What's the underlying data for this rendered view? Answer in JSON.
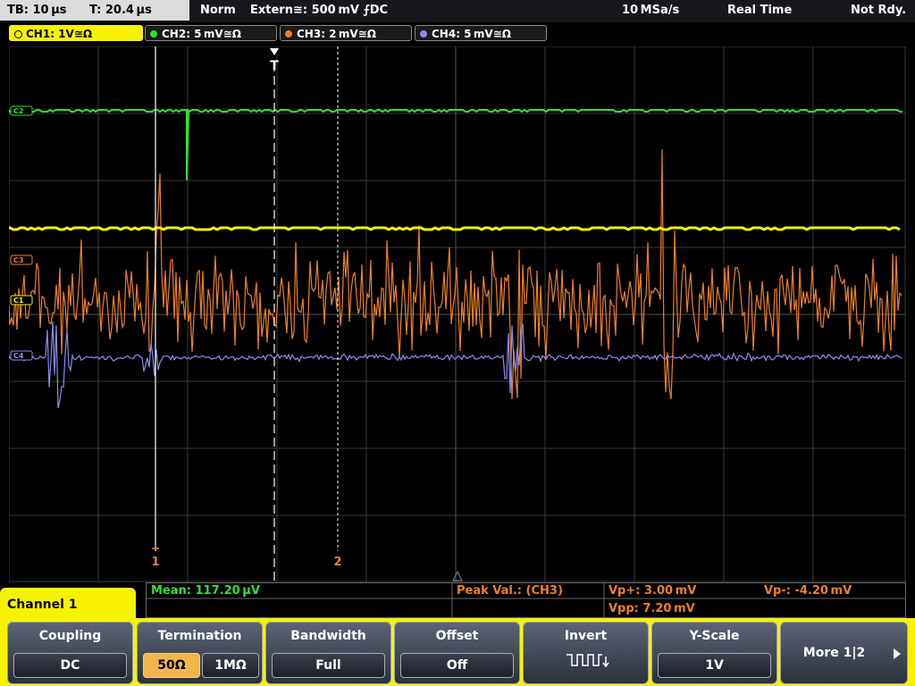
{
  "status_bar": {
    "timebase": "TB: 10 µs",
    "trigger_time": "T: 20.4 µs",
    "mode": "Norm",
    "trigger": "Extern≅: 500 mV ⨍DC",
    "sample_rate": "10 MSa/s",
    "acq_mode": "Real Time",
    "status": "Not Rdy."
  },
  "channels": [
    {
      "label": "CH1: 1V≅Ω",
      "color": "#f6f200",
      "active": true
    },
    {
      "label": "CH2: 5 mV≅Ω",
      "color": "#2fe22f",
      "active": false
    },
    {
      "label": "CH3: 2 mV≅Ω",
      "color": "#f08020",
      "active": false
    },
    {
      "label": "CH4: 5 mV≅Ω",
      "color": "#8c8cf0",
      "active": false
    }
  ],
  "markers": {
    "trigger": "T",
    "cursor1": "1",
    "cursor2": "2",
    "ch2": "C2",
    "ch3": "C3",
    "ch1": "C1",
    "ch4": "C4"
  },
  "measurements": {
    "mean": "Mean: 117.20 µV",
    "peak_label": "Peak Val.:  (CH3)",
    "vp_plus": "Vp+: 3.00 mV",
    "vp_minus": "Vp-: -4.20 mV",
    "vpp": "Vpp: 7.20 mV"
  },
  "menu": {
    "title": "Channel 1",
    "coupling": {
      "label": "Coupling",
      "value": "DC"
    },
    "termination": {
      "label": "Termination",
      "opt1": "50Ω",
      "opt2": "1MΩ"
    },
    "bandwidth": {
      "label": "Bandwidth",
      "value": "Full"
    },
    "offset": {
      "label": "Offset",
      "value": "Off"
    },
    "invert": {
      "label": "Invert",
      "icon": "square-wave-invert-icon"
    },
    "yscale": {
      "label": "Y-Scale",
      "value": "1V"
    },
    "more": {
      "label": "More 1|2"
    }
  }
}
